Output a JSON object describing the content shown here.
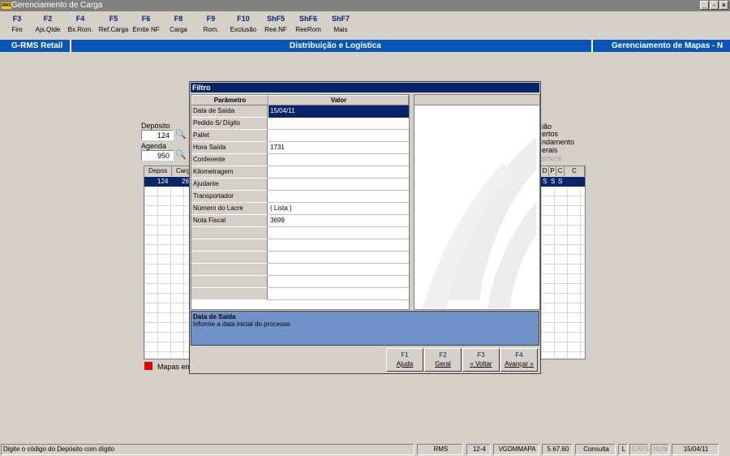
{
  "window": {
    "title": "Gerenciamento de Carga",
    "logo": "RMS"
  },
  "toolbar": [
    {
      "key": "F3",
      "label": "Fim"
    },
    {
      "key": "F2",
      "label": "Ajs.Qtde"
    },
    {
      "key": "F4",
      "label": "Bx.Rom."
    },
    {
      "key": "F5",
      "label": "Ref.Carga"
    },
    {
      "key": "F6",
      "label": "Emite NF"
    },
    {
      "key": "F8",
      "label": "Carga"
    },
    {
      "key": "F9",
      "label": "Rom."
    },
    {
      "key": "F10",
      "label": "Exclusão"
    },
    {
      "key": "ShF5",
      "label": "Ree.NF"
    },
    {
      "key": "ShF6",
      "label": "ReeRom"
    },
    {
      "key": "ShF7",
      "label": "Mais"
    }
  ],
  "header": {
    "left": "G-RMS Retail",
    "center": "Distribuição e Logística",
    "right": "Gerenciamento de Mapas - N"
  },
  "background": {
    "deposito_label": "Depósito",
    "deposito_value": "124",
    "agenda_label": "Agenda",
    "agenda_value": "950",
    "grid_headers": [
      "Depos",
      "Carg"
    ],
    "grid_row": [
      "124",
      "26"
    ],
    "right_headers": [
      "D",
      "P",
      "C",
      "C"
    ],
    "right_row": [
      "S",
      "S",
      "S"
    ],
    "right_labels": [
      "ião",
      "ertos",
      "ndamento",
      "erais",
      "ertece"
    ],
    "legend": "Mapas em l",
    "legend_color": "#e00000"
  },
  "dialog": {
    "title": "Filtro",
    "col_param": "Parâmetro",
    "col_value": "Valor",
    "rows": [
      {
        "param": "Data de Saída",
        "value": "15/04/11"
      },
      {
        "param": "Pedido S/ Dígito",
        "value": ""
      },
      {
        "param": "Pallet",
        "value": ""
      },
      {
        "param": "Hora Saída",
        "value": "1731"
      },
      {
        "param": "Conferente",
        "value": ""
      },
      {
        "param": "Kilometragem",
        "value": ""
      },
      {
        "param": "Ajudante",
        "value": ""
      },
      {
        "param": "Transportador",
        "value": ""
      },
      {
        "param": "Número do Lacre",
        "value": "( Lista )"
      },
      {
        "param": "Nota Fiscal",
        "value": "3699"
      }
    ],
    "help_title": "Data de Saída",
    "help_text": "Informe a data inicial do processo",
    "buttons": [
      {
        "key": "F1",
        "label": "Ajuda"
      },
      {
        "key": "F2",
        "label": "Geral"
      },
      {
        "key": "F3",
        "label": "« Voltar"
      },
      {
        "key": "F4",
        "label": "Avançar »"
      }
    ]
  },
  "status": {
    "message": "Digite o código do Depósito com dígito",
    "system": "RMS",
    "version_code": "12-4",
    "program": "VGDMMAPA",
    "version": "5.67.60",
    "mode": "Consulta",
    "l": "L",
    "caps": "CAPS",
    "num": "NUM",
    "date": "15/04/11"
  },
  "colors": {
    "title_bar": "#808080",
    "header_bar": "#0a56b6",
    "selection": "#0a246a",
    "help_bg": "#7092c8"
  }
}
